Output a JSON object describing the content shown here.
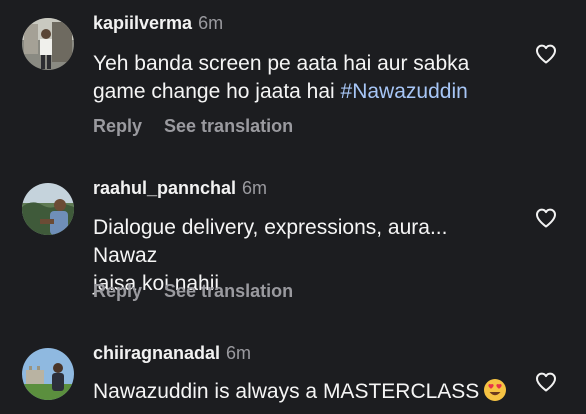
{
  "comments": [
    {
      "username": "kapiilverma",
      "time": "6m",
      "text_line1": "Yeh banda screen pe aata hai aur sabka",
      "text_line2_prefix": "game change ho jaata hai ",
      "hashtag": "#Nawazuddin",
      "reply_label": "Reply",
      "translate_label": "See translation"
    },
    {
      "username": "raahul_pannchal",
      "time": "6m",
      "text_line1": "Dialogue delivery, expressions, aura... Nawaz",
      "text_line2": "jaisa koi nahii",
      "reply_label": "Reply",
      "translate_label": "See translation"
    },
    {
      "username": "chiiragnanadal",
      "time": "6m",
      "text_line1": "Nawazuddin is always a MASTERCLASS"
    }
  ],
  "icons": {
    "like": "heart-outline-icon",
    "emoji": "heart-eyes-emoji-icon"
  },
  "colors": {
    "background": "#1c1d20",
    "text": "#f5f5f5",
    "muted": "#9a9a9f",
    "hashtag": "#a7c6f6"
  }
}
